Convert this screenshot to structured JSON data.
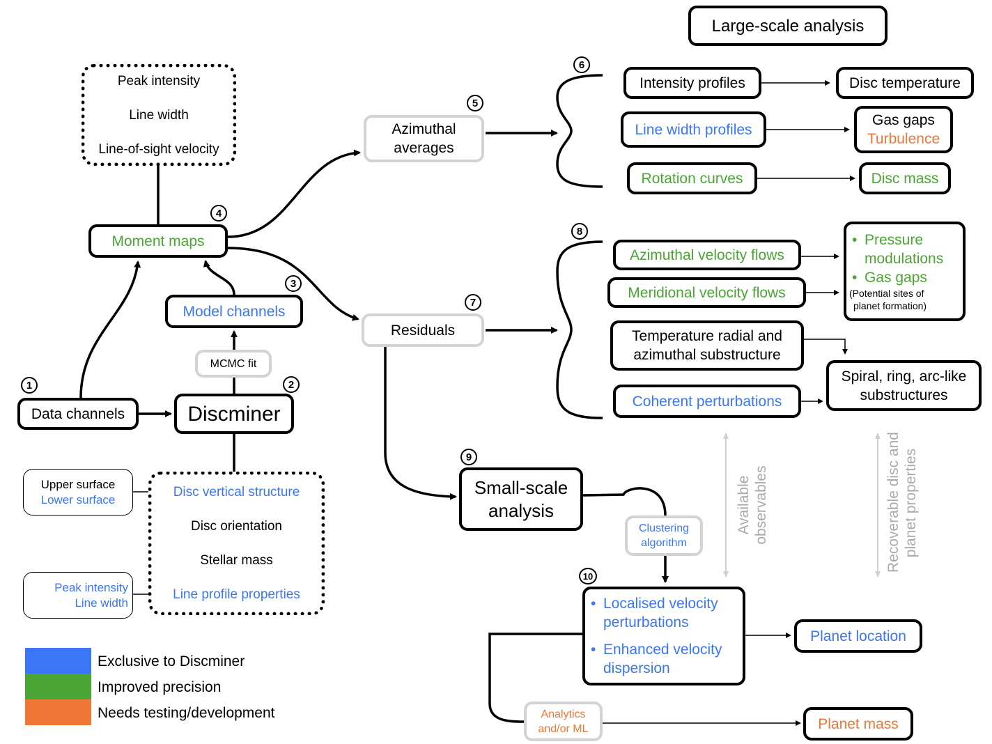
{
  "colors": {
    "exclusive": "#3a76f5",
    "improved": "#4aa535",
    "testing": "#ee7735",
    "secondary_border": "#d3d3d3"
  },
  "nodes": {
    "large_scale": "Large-scale analysis",
    "intensity_profiles": "Intensity profiles",
    "disc_temperature": "Disc temperature",
    "line_width_profiles": "Line width profiles",
    "gas_gaps": "Gas gaps",
    "turbulence": "Turbulence",
    "rotation_curves": "Rotation curves",
    "disc_mass": "Disc mass",
    "azimuthal_averages": [
      "Azimuthal",
      "averages"
    ],
    "azimuthal_flows": "Azimuthal velocity flows",
    "meridional_flows": "Meridional velocity flows",
    "pressure_items": [
      "Pressure",
      "modulations",
      "Gas gaps"
    ],
    "pressure_note": [
      "(Potential sites of",
      "planet formation)"
    ],
    "temperature_sub": [
      "Temperature radial and",
      "azimuthal substructure"
    ],
    "spiral": [
      "Spiral, ring, arc-like",
      "substructures"
    ],
    "coherent": "Coherent perturbations",
    "residuals": "Residuals",
    "moment_maps": "Moment maps",
    "moment_list": [
      "Peak intensity",
      "Line width",
      "Line-of-sight velocity"
    ],
    "model_channels": "Model channels",
    "mcmc": "MCMC fit",
    "discminer": "Discminer",
    "data_channels": "Data channels",
    "disc_params": [
      "Disc vertical structure",
      "Disc orientation",
      "Stellar mass",
      "Line profile properties"
    ],
    "surfaces": [
      "Upper surface",
      "Lower surface"
    ],
    "line_props": [
      "Peak intensity",
      "Line width"
    ],
    "small_scale": [
      "Small-scale",
      "analysis"
    ],
    "clustering": [
      "Clustering",
      "algorithm"
    ],
    "localised": [
      "Localised velocity",
      "perturbations",
      "Enhanced velocity",
      "dispersion"
    ],
    "planet_location": "Planet location",
    "analytics": [
      "Analytics",
      "and/or ML"
    ],
    "planet_mass": "Planet mass",
    "available": [
      "Available",
      "observables"
    ],
    "recoverable": [
      "Recoverable disc and",
      "planet properties"
    ],
    "bullet": "•"
  },
  "step_numbers": [
    "1",
    "2",
    "3",
    "4",
    "5",
    "6",
    "7",
    "8",
    "9",
    "10"
  ],
  "legend": [
    {
      "label": "Exclusive to Discminer",
      "color": "#3a76f5"
    },
    {
      "label": "Improved precision",
      "color": "#4aa535"
    },
    {
      "label": "Needs testing/development",
      "color": "#ee7735"
    }
  ]
}
